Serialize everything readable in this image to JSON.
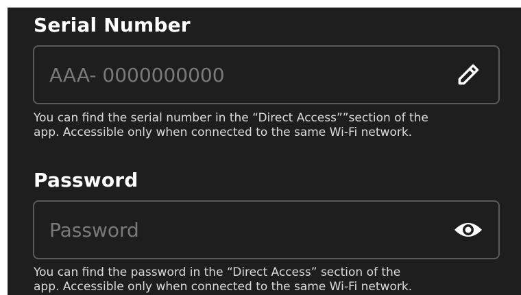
{
  "serial": {
    "label": "Serial Number",
    "placeholder": "AAA- 0000000000",
    "icon": "pencil-icon",
    "help_line1": "You can find the serial number in the “Direct Access””section of the",
    "help_line2": "app. Accessible only when connected to the same Wi-Fi network."
  },
  "password": {
    "label": "Password",
    "placeholder": "Password",
    "icon": "eye-icon",
    "help_line1": "You can find the password in the “Direct Access” section of the",
    "help_line2": "app. Accessible only when connected to the same Wi-Fi network."
  }
}
